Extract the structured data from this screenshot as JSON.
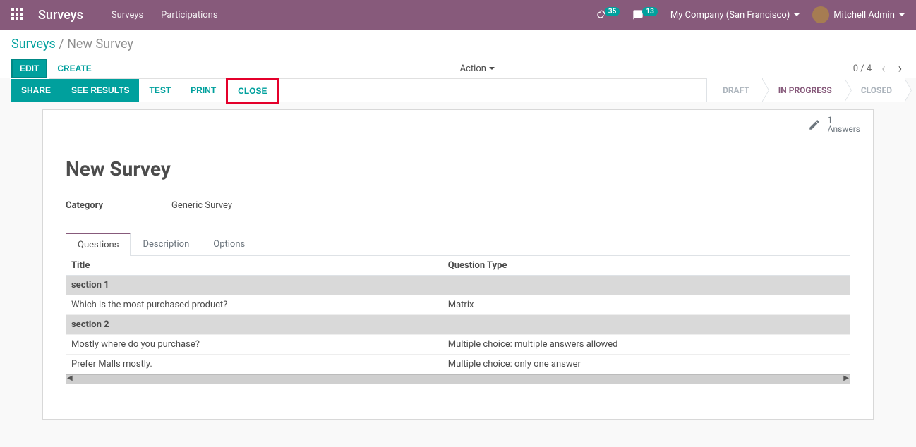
{
  "topnav": {
    "brand": "Surveys",
    "links": [
      "Surveys",
      "Participations"
    ],
    "activity_count": "35",
    "message_count": "13",
    "company": "My Company (San Francisco)",
    "user": "Mitchell Admin"
  },
  "breadcrumb": {
    "root": "Surveys",
    "current": "New Survey"
  },
  "buttons": {
    "edit": "EDIT",
    "create": "CREATE",
    "action": "Action",
    "share": "SHARE",
    "see_results": "SEE RESULTS",
    "test": "TEST",
    "print": "PRINT",
    "close": "CLOSE"
  },
  "pager": {
    "text": "0 / 4"
  },
  "status": {
    "draft": "DRAFT",
    "in_progress": "IN PROGRESS",
    "closed": "CLOSED"
  },
  "stat": {
    "count": "1",
    "label": "Answers"
  },
  "form": {
    "title": "New Survey",
    "category_label": "Category",
    "category_value": "Generic Survey"
  },
  "tabs": {
    "questions": "Questions",
    "description": "Description",
    "options": "Options"
  },
  "table": {
    "col_title": "Title",
    "col_qtype": "Question Type",
    "rows": [
      {
        "kind": "section",
        "title": "section 1",
        "qtype": ""
      },
      {
        "kind": "question",
        "title": "Which is the most purchased product?",
        "qtype": "Matrix"
      },
      {
        "kind": "section",
        "title": "section 2",
        "qtype": ""
      },
      {
        "kind": "question",
        "title": "Mostly where do you purchase?",
        "qtype": "Multiple choice: multiple answers allowed"
      },
      {
        "kind": "question",
        "title": "Prefer Malls mostly.",
        "qtype": "Multiple choice: only one answer"
      }
    ]
  }
}
